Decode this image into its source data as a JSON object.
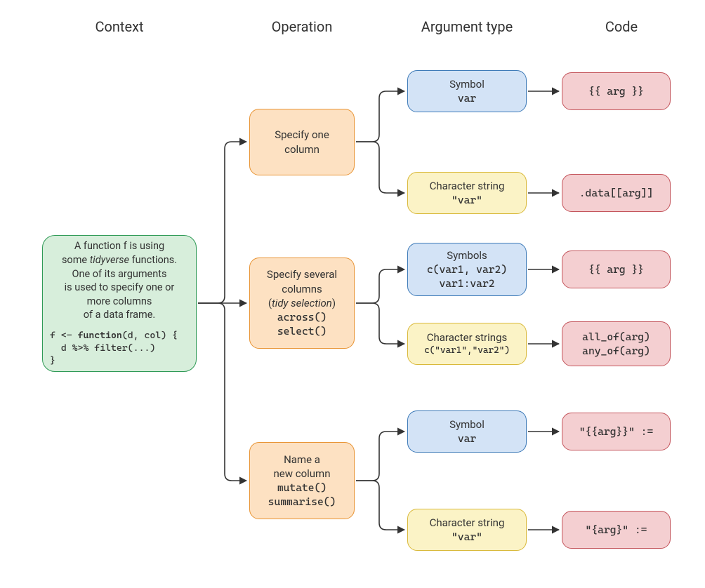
{
  "headers": {
    "context": "Context",
    "operation": "Operation",
    "argtype": "Argument type",
    "code": "Code"
  },
  "context": {
    "line1": "A function f is using",
    "line2a": "some ",
    "line2b": "tidyverse",
    "line2c": " functions.",
    "line3": "One of its arguments",
    "line4": "is used to specify one or",
    "line5": "more columns",
    "line6": "of a data frame.",
    "code1": "f <- ",
    "code1b": "function",
    "code1c": "(d, col) {",
    "code2": "  d %>% filter(...)",
    "code3": "}"
  },
  "op": {
    "one": {
      "l1": "Specify one",
      "l2": "column"
    },
    "sev": {
      "l1": "Specify several",
      "l2": "columns",
      "l3a": "(",
      "l3b": "tidy selection",
      "l3c": ")",
      "l4": "across()",
      "l5": "select()"
    },
    "name": {
      "l1": "Name a",
      "l2": "new column",
      "l3": "mutate()",
      "l4": "summarise()"
    }
  },
  "arg": {
    "a1": {
      "t": "Symbol",
      "c": "var"
    },
    "a2": {
      "t": "Character string",
      "c": "\"var\""
    },
    "a3": {
      "t": "Symbols",
      "c1": "c(var1, var2)",
      "c2": "var1:var2"
    },
    "a4": {
      "t": "Character strings",
      "c": "c(\"var1\",\"var2\")"
    },
    "a5": {
      "t": "Symbol",
      "c": "var"
    },
    "a6": {
      "t": "Character string",
      "c": "\"var\""
    }
  },
  "code": {
    "c1": "{{ arg }}",
    "c2": ".data[[arg]]",
    "c3": "{{ arg }}",
    "c4a": "all_of(arg)",
    "c4b": "any_of(arg)",
    "c5": "\"{{arg}}\" :=",
    "c6": "\"{arg}\" :="
  }
}
